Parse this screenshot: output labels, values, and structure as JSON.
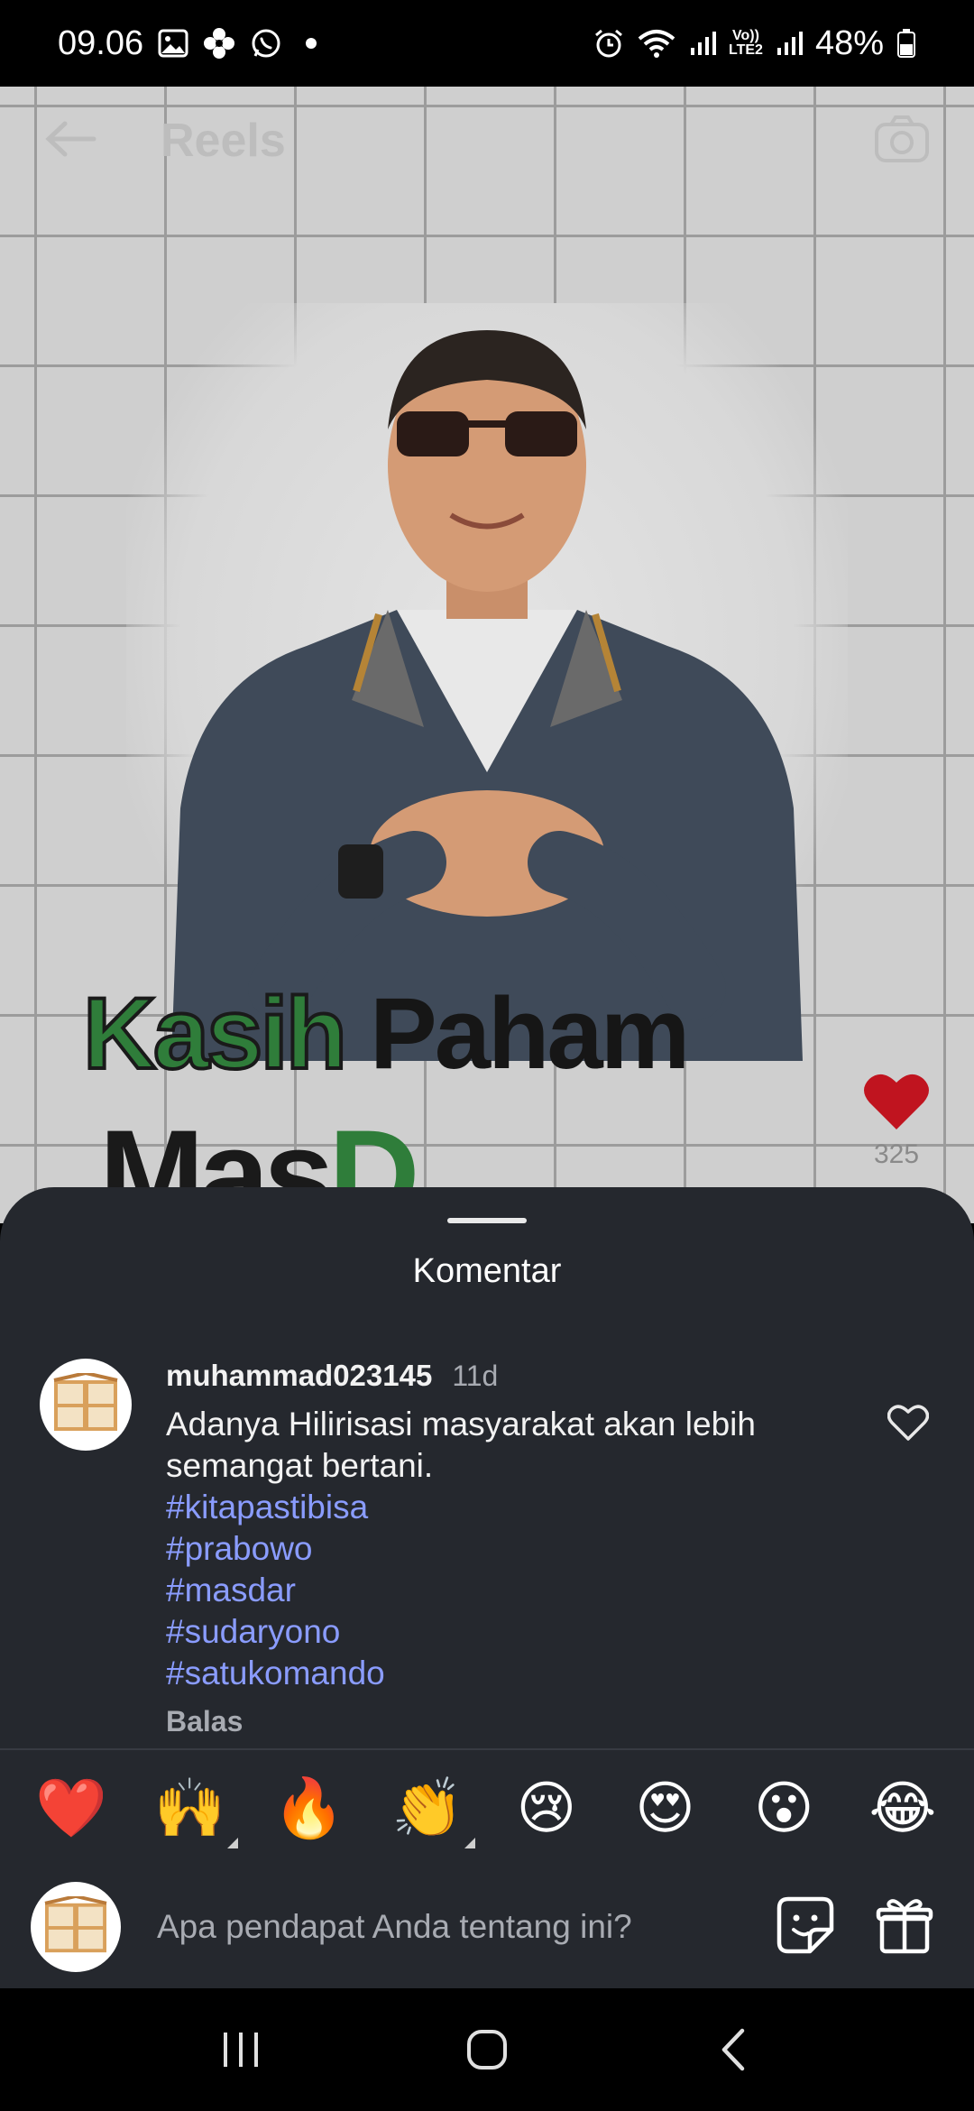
{
  "status_bar": {
    "time": "09.06",
    "lte_label_top": "Vo))",
    "lte_label_bottom": "LTE2",
    "battery": "48%"
  },
  "reel": {
    "title": "Reels",
    "headline_green": "Kasih",
    "headline_black": "Paham",
    "headline_line2_black": "Mas",
    "headline_line2_green": "D",
    "like_count": "325"
  },
  "comments_sheet": {
    "title": "Komentar",
    "comment": {
      "username": "muhammad023145",
      "time": "11d",
      "text": "Adanya Hilirisasi masyarakat akan lebih semangat bertani.",
      "hashtags": [
        "#kitapastibisa",
        "#prabowo",
        "#masdar",
        "#sudaryono",
        "#satukomando"
      ],
      "reply_label": "Balas"
    },
    "reactions": [
      "❤️",
      "🙌",
      "🔥",
      "👏",
      "😢",
      "😍",
      "😮",
      "😂"
    ],
    "input": {
      "placeholder": "Apa pendapat Anda tentang ini?"
    }
  },
  "icons": {
    "back": "arrow-left-icon",
    "camera": "camera-icon",
    "comment_like": "heart-outline-icon",
    "sticker": "sticker-icon",
    "gift": "gift-icon",
    "nav_recent": "recent-apps-icon",
    "nav_home": "home-icon",
    "nav_back": "back-icon"
  },
  "colors": {
    "sheet_bg": "#25282e",
    "hashtag": "#8a9cff",
    "muted_text": "#a8abb2",
    "heart_red": "#c0141f"
  }
}
